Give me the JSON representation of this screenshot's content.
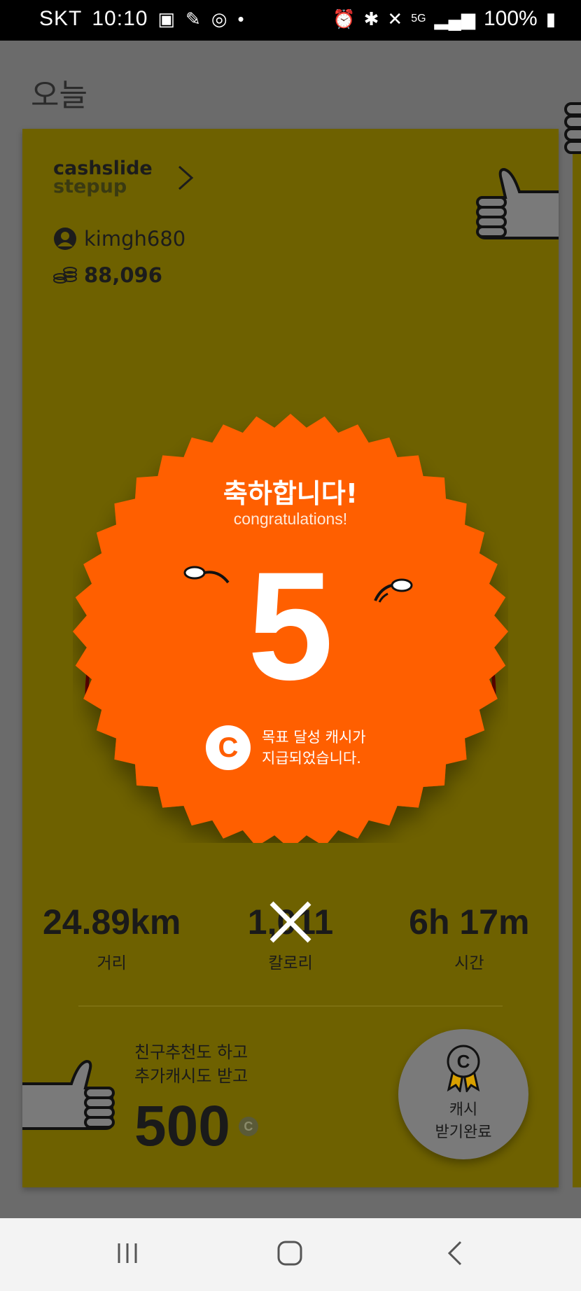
{
  "status_bar": {
    "carrier": "SKT",
    "time": "10:10",
    "battery": "100%",
    "network": "5G"
  },
  "page": {
    "title": "오늘"
  },
  "card": {
    "brand_line1": "cashslide",
    "brand_line2": "stepup",
    "username": "kimgh680",
    "cash_balance": "88,096",
    "congrats_ko": "축하합니다!",
    "congrats_en": "congratulations!",
    "reward_amount": "5",
    "reward_msg_line1": "목표 달성 캐시가",
    "reward_msg_line2": "지급되었습니다.",
    "stats": [
      {
        "value": "24.89km",
        "label": "거리"
      },
      {
        "value": "1,011",
        "label": "칼로리"
      },
      {
        "value": "6h 17m",
        "label": "시간"
      }
    ],
    "promo_line1": "친구추천도 하고",
    "promo_line2": "추가캐시도 받고",
    "promo_amount": "500",
    "promo_coin": "C",
    "collect_line1": "캐시",
    "collect_line2": "받기완료"
  },
  "colors": {
    "card_bg": "#6e6100",
    "badge": "#ff5e00",
    "arc": "#6a0000",
    "overlay": "#6b6b6b"
  }
}
